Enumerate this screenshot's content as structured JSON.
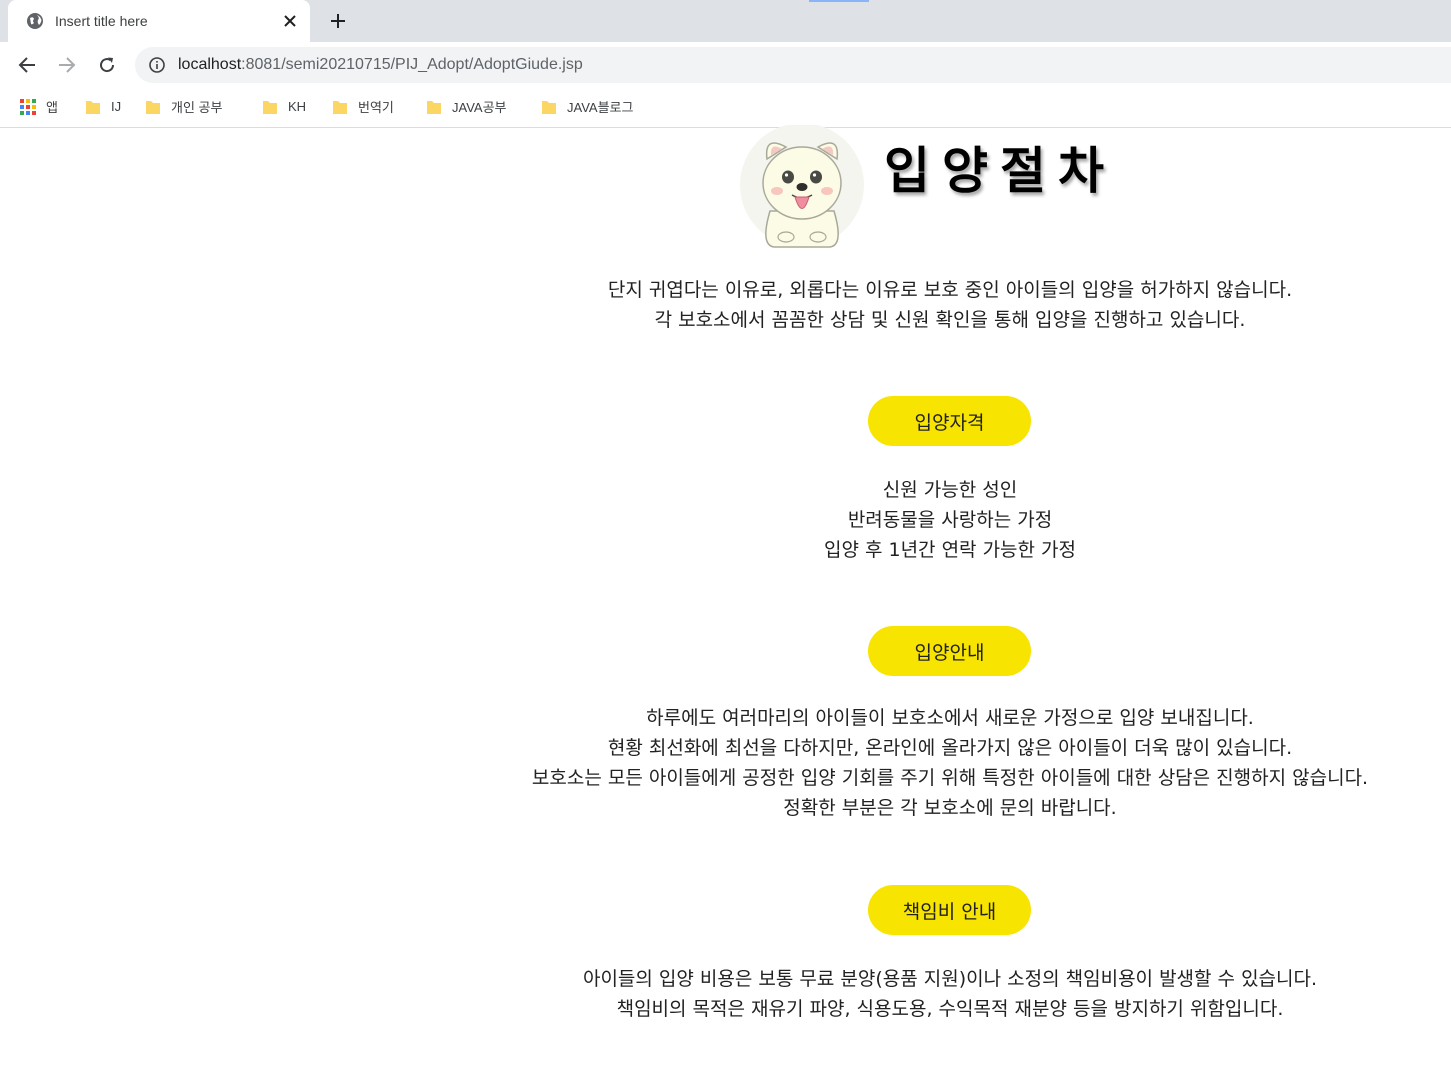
{
  "browser": {
    "tab_title": "Insert title here",
    "url_host": "localhost",
    "url_rest": ":8081/semi20210715/PIJ_Adopt/AdoptGiude.jsp",
    "bookmarks": [
      {
        "label": "앱",
        "icon": "apps-icon"
      },
      {
        "label": "IJ",
        "icon": "folder-icon"
      },
      {
        "label": "개인 공부",
        "icon": "folder-icon"
      },
      {
        "label": "KH",
        "icon": "folder-icon"
      },
      {
        "label": "번역기",
        "icon": "folder-icon"
      },
      {
        "label": "JAVA공부",
        "icon": "folder-icon"
      },
      {
        "label": "JAVA블로그",
        "icon": "folder-icon"
      }
    ]
  },
  "page": {
    "title": "입양절차",
    "intro": [
      "단지 귀엽다는 이유로, 외롭다는 이유로 보호 중인 아이들의 입양을 허가하지 않습니다.",
      "각 보호소에서 꼼꼼한 상담 및 신원 확인을 통해 입양을 진행하고 있습니다."
    ],
    "sections": [
      {
        "button": "입양자격",
        "lines": [
          "신원 가능한 성인",
          "반려동물을 사랑하는 가정",
          "입양 후 1년간 연락 가능한 가정"
        ]
      },
      {
        "button": "입양안내",
        "lines": [
          "하루에도 여러마리의 아이들이 보호소에서 새로운 가정으로 입양 보내집니다.",
          "현황 최선화에 최선을 다하지만, 온라인에 올라가지 않은 아이들이 더욱 많이 있습니다.",
          "보호소는 모든 아이들에게 공정한 입양 기회를 주기 위해 특정한 아이들에 대한 상담은 진행하지 않습니다.",
          "정확한 부분은 각 보호소에 문의 바랍니다."
        ]
      },
      {
        "button": "책임비 안내",
        "lines": [
          "아이들의 입양 비용은 보통 무료 분양(용품 지원)이나 소정의 책임비용이 발생할 수 있습니다.",
          "책임비의 목적은 재유기 파양, 식용도용, 수익목적 재분양 등을 방지하기 위함입니다."
        ]
      }
    ],
    "colors": {
      "button_bg": "#f7e400",
      "text": "#222222"
    }
  }
}
